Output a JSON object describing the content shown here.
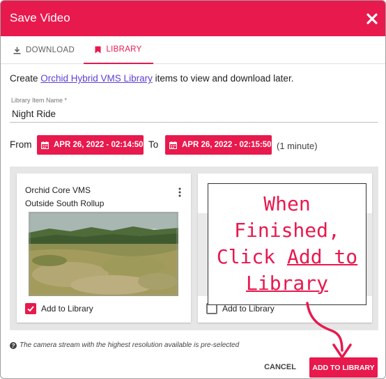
{
  "dialog": {
    "title": "Save Video"
  },
  "tabs": [
    {
      "label": "DOWNLOAD",
      "icon": "download-icon"
    },
    {
      "label": "LIBRARY",
      "icon": "bookmark-icon"
    }
  ],
  "intro": {
    "prefix": "Create ",
    "link": "Orchid Hybrid VMS Library",
    "suffix": " items to view and download later."
  },
  "library_item": {
    "label": "Library Item Name *",
    "value": "Night Ride"
  },
  "range": {
    "from_label": "From",
    "from_value": "APR 26, 2022 - 02:14:50",
    "to_label": "To",
    "to_value": "APR 26, 2022 - 02:15:50",
    "duration": "(1 minute)"
  },
  "cameras": [
    {
      "line1": "Orchid Core VMS",
      "line2": "Outside South Rollup",
      "checkbox_label": "Add to Library",
      "checked": true
    },
    {
      "line1": "",
      "line2": "",
      "checkbox_label": "Add to Library",
      "checked": false
    }
  ],
  "note": "The camera stream with the highest resolution available is pre-selected",
  "buttons": {
    "cancel": "CANCEL",
    "add": "ADD TO LIBRARY"
  },
  "callout": {
    "line1": "When",
    "line2": "Finished,",
    "line3_prefix": "Click ",
    "line3_link": "Add to",
    "line4_link": "Library"
  },
  "colors": {
    "accent": "#e8194d",
    "link": "#5d3fd3"
  }
}
